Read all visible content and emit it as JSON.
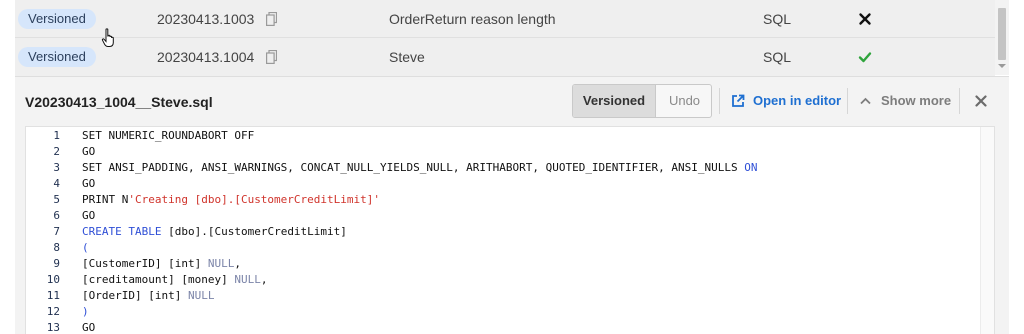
{
  "migrations": [
    {
      "status": "Versioned",
      "version": "20230413.1003",
      "description": "OrderReturn reason length",
      "type": "SQL",
      "result": "error"
    },
    {
      "status": "Versioned",
      "version": "20230413.1004",
      "description": "Steve",
      "type": "SQL",
      "result": "success"
    }
  ],
  "panel": {
    "title": "V20230413_1004__Steve.sql",
    "toggle": {
      "active": "Versioned",
      "inactive": "Undo"
    },
    "open_in_editor": "Open in editor",
    "show_more": "Show more"
  },
  "editor": {
    "lines": [
      {
        "n": "1",
        "parts": [
          {
            "t": "SET NUMERIC_ROUNDABORT OFF",
            "c": ""
          }
        ]
      },
      {
        "n": "2",
        "parts": [
          {
            "t": "GO",
            "c": ""
          }
        ]
      },
      {
        "n": "3",
        "parts": [
          {
            "t": "SET ANSI_PADDING, ANSI_WARNINGS, CONCAT_NULL_YIELDS_NULL, ARITHABORT, QUOTED_IDENTIFIER, ANSI_NULLS ",
            "c": ""
          },
          {
            "t": "ON",
            "c": "kw"
          }
        ]
      },
      {
        "n": "4",
        "parts": [
          {
            "t": "GO",
            "c": ""
          }
        ]
      },
      {
        "n": "5",
        "parts": [
          {
            "t": "PRINT N",
            "c": ""
          },
          {
            "t": "'Creating [dbo].[CustomerCreditLimit]'",
            "c": "str"
          }
        ]
      },
      {
        "n": "6",
        "parts": [
          {
            "t": "GO",
            "c": ""
          }
        ]
      },
      {
        "n": "7",
        "parts": [
          {
            "t": "CREATE TABLE",
            "c": "kw"
          },
          {
            "t": " [dbo].[CustomerCreditLimit]",
            "c": ""
          }
        ]
      },
      {
        "n": "8",
        "parts": [
          {
            "t": "(",
            "c": "kw"
          }
        ]
      },
      {
        "n": "9",
        "parts": [
          {
            "t": "[CustomerID] [int] ",
            "c": ""
          },
          {
            "t": "NULL",
            "c": "null"
          },
          {
            "t": ",",
            "c": ""
          }
        ]
      },
      {
        "n": "10",
        "parts": [
          {
            "t": "[creditamount] [money] ",
            "c": ""
          },
          {
            "t": "NULL",
            "c": "null"
          },
          {
            "t": ",",
            "c": ""
          }
        ]
      },
      {
        "n": "11",
        "parts": [
          {
            "t": "[OrderID] [int] ",
            "c": ""
          },
          {
            "t": "NULL",
            "c": "null"
          }
        ]
      },
      {
        "n": "12",
        "parts": [
          {
            "t": ")",
            "c": "kw"
          }
        ]
      },
      {
        "n": "13",
        "parts": [
          {
            "t": "GO",
            "c": ""
          }
        ]
      }
    ]
  },
  "icons": {
    "copy": "copy-icon",
    "error": "x-mark-icon",
    "success": "checkmark-icon",
    "external": "external-link-icon",
    "chevron": "chevron-up-icon",
    "close": "close-icon",
    "cursor": "hand-pointer-icon"
  },
  "colors": {
    "badge_bg": "#d6e6fb",
    "link": "#1e6fd1",
    "keyword": "#2f4fd6",
    "string": "#d0342c",
    "success": "#2fa43c"
  }
}
